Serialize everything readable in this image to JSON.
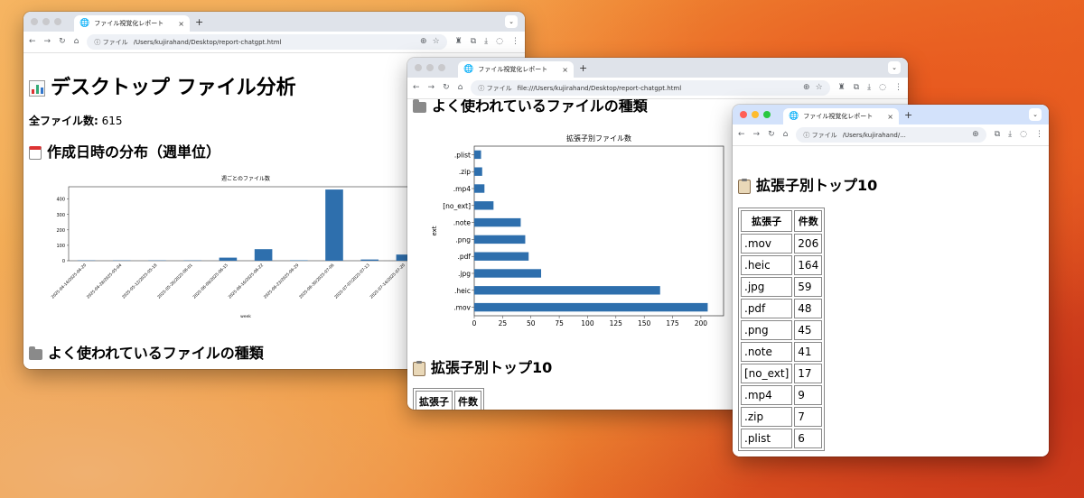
{
  "browser": {
    "tab_title": "ファイル視覚化レポート",
    "tab_close": "×",
    "new_tab": "+",
    "omni_info": "ⓘ ファイル",
    "w1_url": "/Users/kujirahand/Desktop/report-chatgpt.html",
    "w2_url": "file:///Users/kujirahand/Desktop/report-chatgpt.html",
    "w3_url": "/Users/kujirahand/..."
  },
  "report": {
    "title": "デスクトップ ファイル分析",
    "total_label": "全ファイル数:",
    "total_value": "615",
    "section_created": "作成日時の分布（週単位）",
    "section_types": "よく使われているファイルの種類",
    "section_top10": "拡張子別トップ10"
  },
  "table": {
    "headers": [
      "拡張子",
      "件数"
    ],
    "rows": [
      [
        ".mov",
        "206"
      ],
      [
        ".heic",
        "164"
      ],
      [
        ".jpg",
        "59"
      ],
      [
        ".pdf",
        "48"
      ],
      [
        ".png",
        "45"
      ],
      [
        ".note",
        "41"
      ],
      [
        "[no_ext]",
        "17"
      ],
      [
        ".mp4",
        "9"
      ],
      [
        ".zip",
        "7"
      ],
      [
        ".plist",
        "6"
      ]
    ]
  },
  "chart_data": [
    {
      "type": "bar",
      "title": "週ごとのファイル数",
      "xlabel": "week",
      "ylabel": "",
      "categories": [
        "2025-04-14/2025-04-20",
        "2025-04-28/2025-05-04",
        "2025-05-12/2025-05-18",
        "2025-05-26/2025-06-01",
        "2025-06-09/2025-06-15",
        "2025-06-16/2025-06-22",
        "2025-06-23/2025-06-29",
        "2025-06-30/2025-07-06",
        "2025-07-07/2025-07-13",
        "2025-07-14/2025-07-20"
      ],
      "values": [
        2,
        2,
        2,
        2,
        20,
        75,
        3,
        462,
        8,
        40
      ],
      "ylim": [
        0,
        480
      ],
      "yticks": [
        0,
        100,
        200,
        300,
        400
      ],
      "color": "#2e6fad"
    },
    {
      "type": "bar",
      "orientation": "horizontal",
      "title": "拡張子別ファイル数",
      "xlabel": "",
      "ylabel": "ext",
      "categories": [
        ".mov",
        ".heic",
        ".jpg",
        ".pdf",
        ".png",
        ".note",
        "[no_ext]",
        ".mp4",
        ".zip",
        ".plist"
      ],
      "values": [
        206,
        164,
        59,
        48,
        45,
        41,
        17,
        9,
        7,
        6
      ],
      "xlim": [
        0,
        220
      ],
      "xticks": [
        0,
        25,
        50,
        75,
        100,
        125,
        150,
        175,
        200
      ],
      "color": "#2e6fad"
    }
  ]
}
